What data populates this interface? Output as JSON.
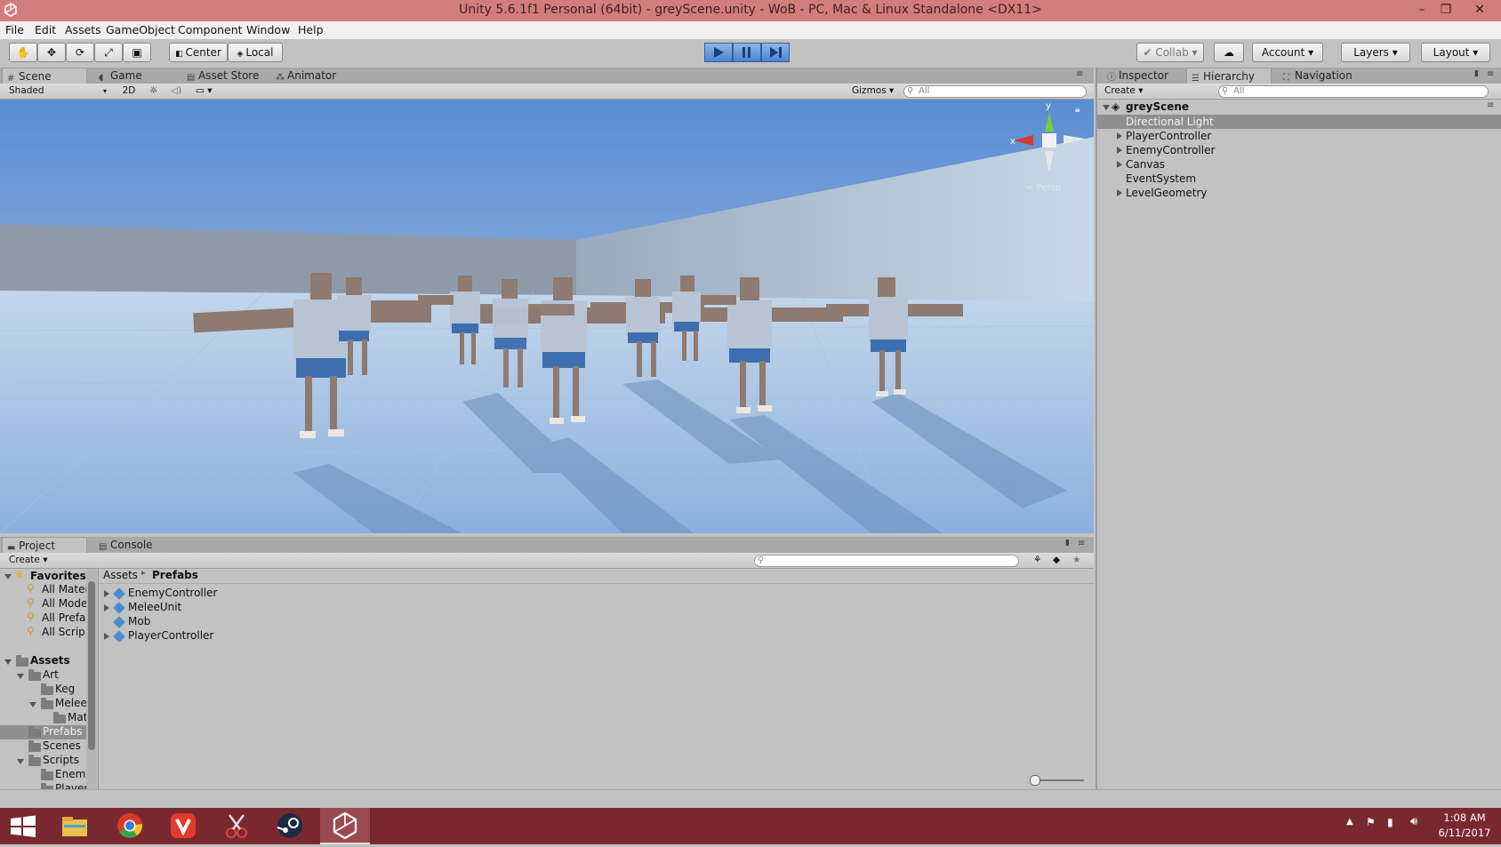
{
  "window": {
    "title": "Unity 5.6.1f1 Personal (64bit) - greyScene.unity - WoB - PC, Mac & Linux Standalone <DX11>",
    "minimize": "–",
    "maximize": "❐",
    "close": "✕"
  },
  "menu": [
    "File",
    "Edit",
    "Assets",
    "GameObject",
    "Component",
    "Window",
    "Help"
  ],
  "toolbar": {
    "pivot_label": "Center",
    "space_label": "Local",
    "collab_label": "Collab",
    "account_label": "Account",
    "layers_label": "Layers",
    "layout_label": "Layout"
  },
  "scene_tabs": [
    "Scene",
    "Game",
    "Asset Store",
    "Animator"
  ],
  "scene_bar": {
    "shading": "Shaded",
    "mode_2d": "2D",
    "gizmos": "Gizmos",
    "search_placeholder": "All"
  },
  "gizmo": {
    "y": "y",
    "x": "x",
    "persp": "< Persp"
  },
  "right_tabs": [
    "Inspector",
    "Hierarchy",
    "Navigation"
  ],
  "hierarchy": {
    "create_label": "Create",
    "search_placeholder": "All",
    "scene_name": "greyScene",
    "items": [
      {
        "label": "Directional Light",
        "expandable": false,
        "selected": true
      },
      {
        "label": "PlayerController",
        "expandable": true,
        "selected": false
      },
      {
        "label": "EnemyController",
        "expandable": true,
        "selected": false
      },
      {
        "label": "Canvas",
        "expandable": true,
        "selected": false
      },
      {
        "label": "EventSystem",
        "expandable": false,
        "selected": false
      },
      {
        "label": "LevelGeometry",
        "expandable": true,
        "selected": false
      }
    ]
  },
  "bottom_tabs": [
    "Project",
    "Console"
  ],
  "project": {
    "create_label": "Create",
    "breadcrumb_root": "Assets",
    "breadcrumb_current": "Prefabs",
    "favorites_label": "Favorites",
    "favorites": [
      "All Mater",
      "All Mode",
      "All Prefa",
      "All Scrip"
    ],
    "assets_label": "Assets",
    "tree": [
      {
        "label": "Art",
        "indent": 1,
        "open": true,
        "selected": false
      },
      {
        "label": "Keg",
        "indent": 2,
        "open": false,
        "selected": false
      },
      {
        "label": "Melee",
        "indent": 2,
        "open": true,
        "selected": false
      },
      {
        "label": "Mat",
        "indent": 3,
        "open": false,
        "selected": false
      },
      {
        "label": "Prefabs",
        "indent": 1,
        "open": false,
        "selected": true
      },
      {
        "label": "Scenes",
        "indent": 1,
        "open": false,
        "selected": false
      },
      {
        "label": "Scripts",
        "indent": 1,
        "open": true,
        "selected": false
      },
      {
        "label": "Enem",
        "indent": 2,
        "open": false,
        "selected": false
      },
      {
        "label": "Player",
        "indent": 2,
        "open": false,
        "selected": false
      }
    ],
    "prefabs": [
      {
        "label": "EnemyController",
        "expandable": true
      },
      {
        "label": "MeleeUnit",
        "expandable": true
      },
      {
        "label": "Mob",
        "expandable": false
      },
      {
        "label": "PlayerController",
        "expandable": true
      }
    ]
  },
  "taskbar": {
    "time": "1:08 AM",
    "date": "6/11/2017",
    "apps": [
      "start-button",
      "file-explorer",
      "chrome",
      "vivaldi",
      "snipping-tool",
      "steam",
      "unity"
    ]
  },
  "colors": {
    "titlebar": "#d27d7d",
    "taskbar": "#7a2830",
    "selection": "#8f8f8f",
    "play_blue": "#4a84cf"
  }
}
